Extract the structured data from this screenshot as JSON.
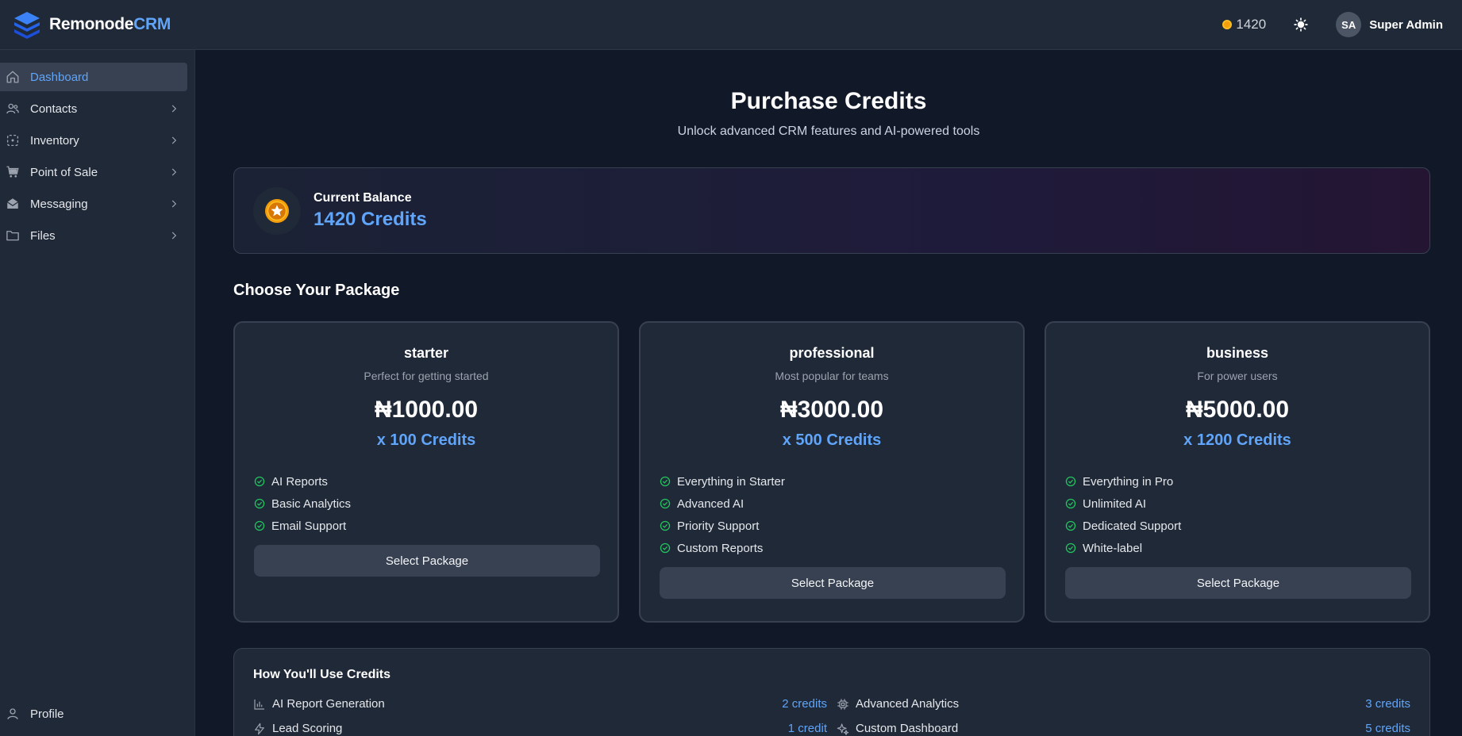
{
  "header": {
    "brand_primary": "Remonode",
    "brand_accent": "CRM",
    "coins": "1420",
    "user_initials": "SA",
    "user_name": "Super Admin"
  },
  "sidebar": {
    "items": [
      {
        "label": "Dashboard",
        "icon": "home-icon",
        "active": true
      },
      {
        "label": "Contacts",
        "icon": "users-icon"
      },
      {
        "label": "Inventory",
        "icon": "box-icon"
      },
      {
        "label": "Point of Sale",
        "icon": "cart-icon"
      },
      {
        "label": "Messaging",
        "icon": "mail-icon"
      },
      {
        "label": "Files",
        "icon": "folder-icon"
      }
    ],
    "profile_label": "Profile"
  },
  "page": {
    "title": "Purchase Credits",
    "subtitle": "Unlock advanced CRM features and AI-powered tools"
  },
  "balance": {
    "label": "Current Balance",
    "value": "1420 Credits"
  },
  "packages_heading": "Choose Your Package",
  "packages": [
    {
      "name": "starter",
      "description": "Perfect for getting started",
      "price": "₦1000.00",
      "credits": "x 100 Credits",
      "features": [
        "AI Reports",
        "Basic Analytics",
        "Email Support"
      ],
      "button": "Select Package"
    },
    {
      "name": "professional",
      "description": "Most popular for teams",
      "price": "₦3000.00",
      "credits": "x 500 Credits",
      "features": [
        "Everything in Starter",
        "Advanced AI",
        "Priority Support",
        "Custom Reports"
      ],
      "button": "Select Package"
    },
    {
      "name": "business",
      "description": "For power users",
      "price": "₦5000.00",
      "credits": "x 1200 Credits",
      "features": [
        "Everything in Pro",
        "Unlimited AI",
        "Dedicated Support",
        "White-label"
      ],
      "button": "Select Package"
    }
  ],
  "usage": {
    "title": "How You'll Use Credits",
    "items": [
      {
        "label": "AI Report Generation",
        "cost": "2 credits",
        "icon": "bar-chart-icon"
      },
      {
        "label": "Advanced Analytics",
        "cost": "3 credits",
        "icon": "chip-icon"
      },
      {
        "label": "Lead Scoring",
        "cost": "1 credit",
        "icon": "bolt-icon"
      },
      {
        "label": "Custom Dashboard",
        "cost": "5 credits",
        "icon": "sparkle-icon"
      }
    ]
  },
  "colors": {
    "accent": "#60a5fa",
    "background": "#111827",
    "panel": "#1f2937",
    "check": "#22c55e",
    "coin": "#f59e0b"
  }
}
